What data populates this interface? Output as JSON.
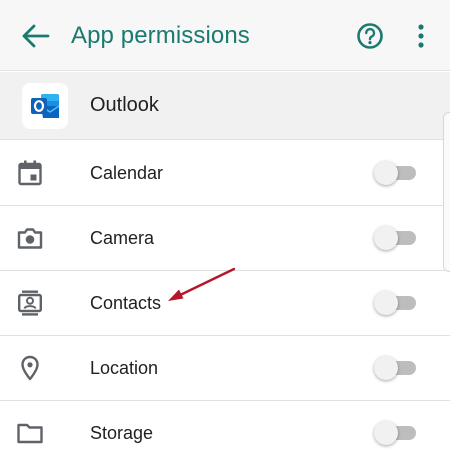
{
  "header": {
    "title": "App permissions",
    "back_icon": "arrow-left-icon",
    "help_icon": "help-circle-icon",
    "more_icon": "more-vert-icon"
  },
  "app": {
    "name": "Outlook",
    "icon": "outlook-logo-icon"
  },
  "permissions": [
    {
      "label": "Calendar",
      "icon": "calendar-icon",
      "enabled": false
    },
    {
      "label": "Camera",
      "icon": "camera-icon",
      "enabled": false
    },
    {
      "label": "Contacts",
      "icon": "contacts-icon",
      "enabled": false
    },
    {
      "label": "Location",
      "icon": "location-pin-icon",
      "enabled": false
    },
    {
      "label": "Storage",
      "icon": "folder-icon",
      "enabled": false
    }
  ],
  "colors": {
    "accent": "#1b7a70",
    "annotation_arrow": "#b5172a",
    "toggle_off_track": "#bdbdbd"
  }
}
